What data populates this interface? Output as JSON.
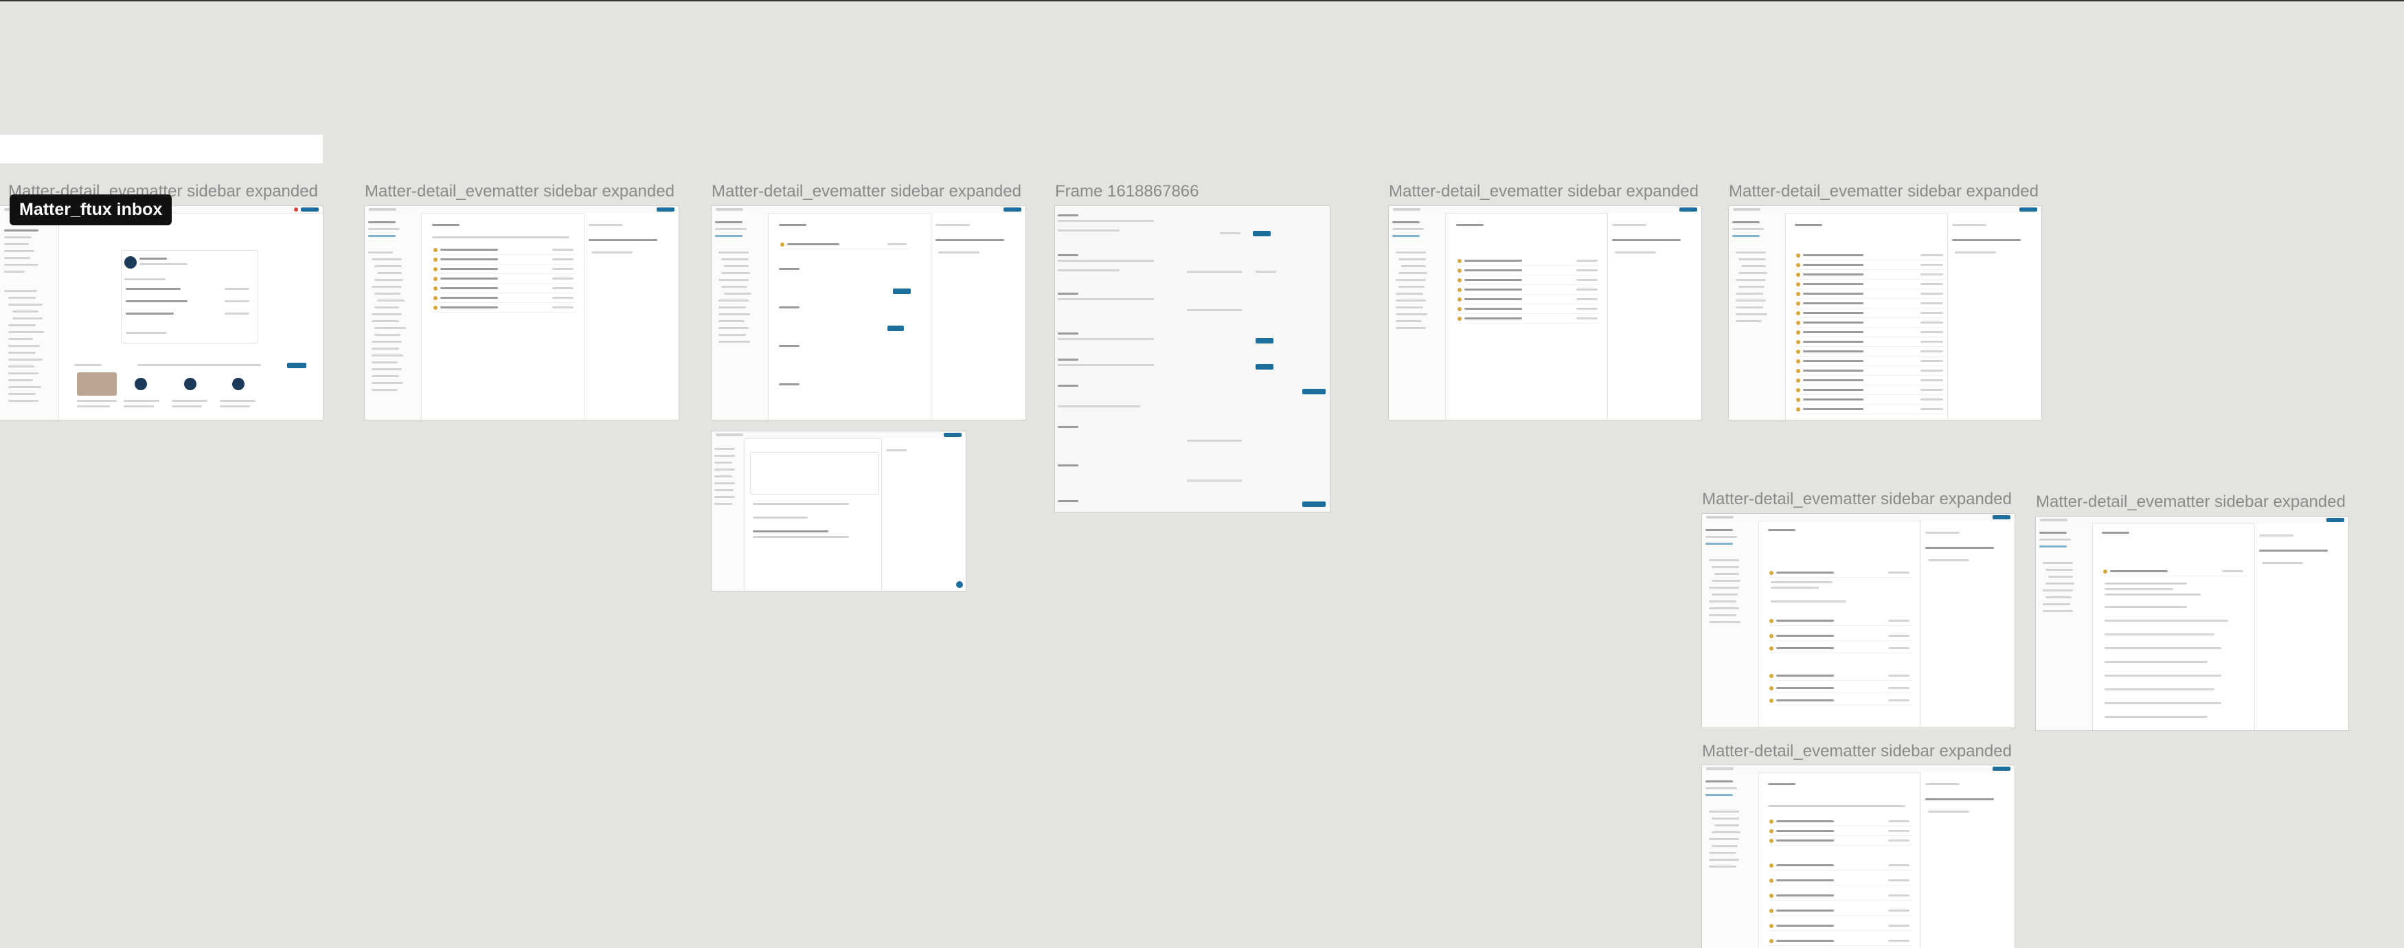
{
  "canvas": {
    "background": "#e3e3e0",
    "accent": "#1c6e9c"
  },
  "tooltip": {
    "text": "Matter_ftux inbox"
  },
  "frames": [
    {
      "id": "f1",
      "label": "Matter-detail_evematter sidebar expanded"
    },
    {
      "id": "f2",
      "label": "Matter-detail_evematter sidebar expanded"
    },
    {
      "id": "f3",
      "label": "Matter-detail_evematter sidebar expanded"
    },
    {
      "id": "f4",
      "label": "Frame 1618867866"
    },
    {
      "id": "f5",
      "label": "Matter-detail_evematter sidebar expanded"
    },
    {
      "id": "f6",
      "label": "Matter-detail_evematter sidebar expanded"
    },
    {
      "id": "f7",
      "label": "Matter-detail_evematter sidebar expanded"
    },
    {
      "id": "f8",
      "label": "Matter-detail_evematter sidebar expanded"
    },
    {
      "id": "f9",
      "label": "Matter-detail_evematter sidebar expanded"
    }
  ],
  "icons": [
    "sidebar-icon",
    "help-icon",
    "avatar-icon"
  ]
}
